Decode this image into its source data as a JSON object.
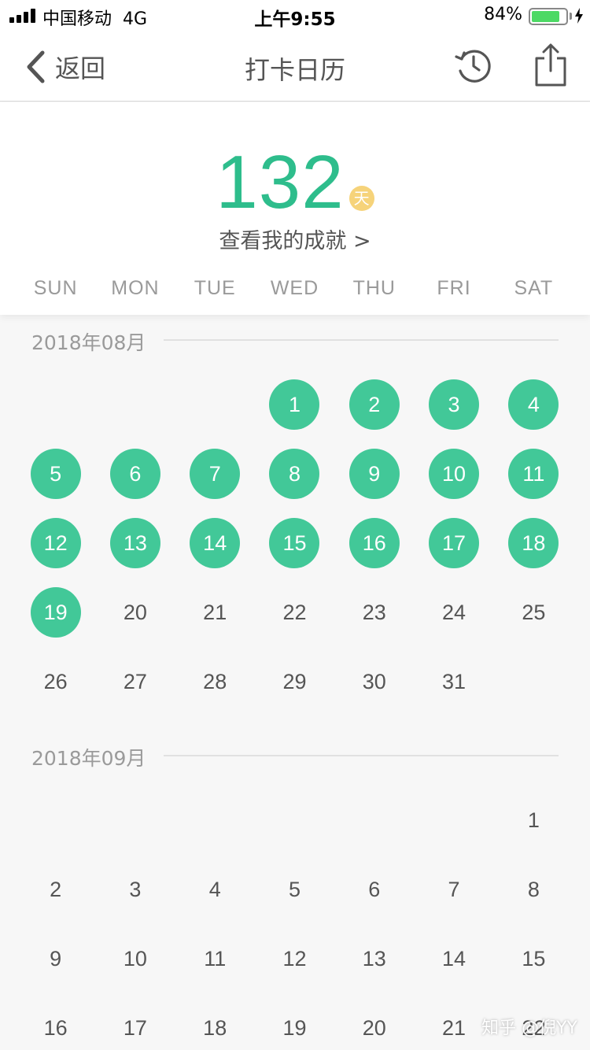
{
  "status_bar": {
    "carrier": "中国移动",
    "network": "4G",
    "time": "上午9:55",
    "battery_percent": "84%",
    "battery_level": 0.84
  },
  "nav": {
    "back_label": "返回",
    "title": "打卡日历"
  },
  "summary": {
    "days_count": "132",
    "days_unit": "天",
    "achievements_link": "查看我的成就 >"
  },
  "weekdays": [
    "SUN",
    "MON",
    "TUE",
    "WED",
    "THU",
    "FRI",
    "SAT"
  ],
  "months": [
    {
      "title": "2018年08月",
      "first_weekday": 3,
      "days_in_month": 31,
      "checked_days": [
        1,
        2,
        3,
        4,
        5,
        6,
        7,
        8,
        9,
        10,
        11,
        12,
        13,
        14,
        15,
        16,
        17,
        18,
        19
      ]
    },
    {
      "title": "2018年09月",
      "first_weekday": 6,
      "days_in_month": 22,
      "checked_days": []
    }
  ],
  "watermark": "知乎 @倪YY",
  "colors": {
    "accent_green": "#2ebd8c",
    "checked_circle": "#42c898",
    "badge_yellow": "#f6d37a"
  }
}
